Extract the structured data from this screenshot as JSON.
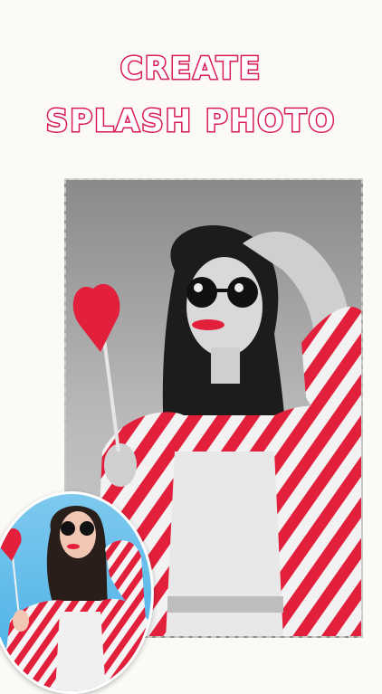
{
  "headline": {
    "line1": "CREATE",
    "line2": "SPLASH PHOTO"
  },
  "colors": {
    "accent": "#d81b57",
    "background": "#fbfaf6",
    "preview_bg": "#45aee6",
    "splash_red": "#e3203b"
  },
  "icons": {
    "heart": "heart-icon"
  }
}
